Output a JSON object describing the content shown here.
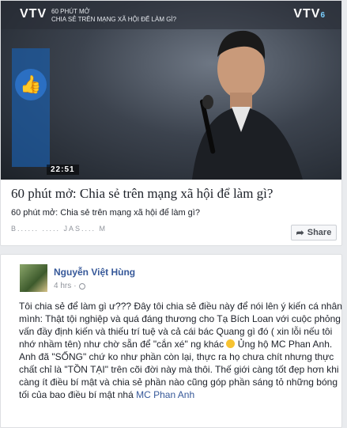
{
  "video": {
    "channel_logo": "VTV",
    "program_title": "60 PHÚT MỞ",
    "program_subtitle": "CHIA SẺ TRÊN MẠNG XÃ HỘI ĐỂ LÀM GÌ?",
    "channel_right": "VTV",
    "channel_right_num": "6",
    "timestamp": "22:51"
  },
  "link": {
    "title": "60 phút mở: Chia sẻ trên mạng xã hội để làm gì?",
    "description": "60 phút mở: Chia sẻ trên mạng xã hội để làm gì?",
    "domain": "B...... ..... JAS.... M"
  },
  "share_button": {
    "label": "Share"
  },
  "post": {
    "author": "Nguyễn Việt Hùng",
    "time": "4 hrs",
    "text_main": "Tôi chia sẻ để làm gì ư??? Đây tôi chia sẻ điều này để nói lên ý kiến cá nhân mình: Thật tội nghiệp và quá đáng thương cho Tạ Bích Loan với cuộc phỏng vấn đầy định kiến và thiếu trí tuệ và cả cái bác Quang gì đó ( xin lỗi nếu tôi nhớ nhầm tên) như chờ sẵn để \"cắn xé\" ng khác",
    "text_after_emoji": "Ủng hộ MC Phan Anh. Anh đã \"SỐNG\" chứ ko như phần còn lại, thực ra họ chưa chít nhưng thực chất chỉ là \"TỒN TẠI\" trên cõi đời này mà thôi. Thế giới càng tốt đẹp hơn khi càng ít điều bí mật và chia sẻ phần nào cũng góp phần sáng tỏ những bóng tối của bao điều bí mật nhá ",
    "mention": "MC Phan Anh"
  },
  "icons": {
    "share": "share-arrow-icon",
    "privacy": "globe-icon",
    "emoji": "smiley-emoji-icon",
    "thumbs_up": "thumbs-up-icon"
  }
}
